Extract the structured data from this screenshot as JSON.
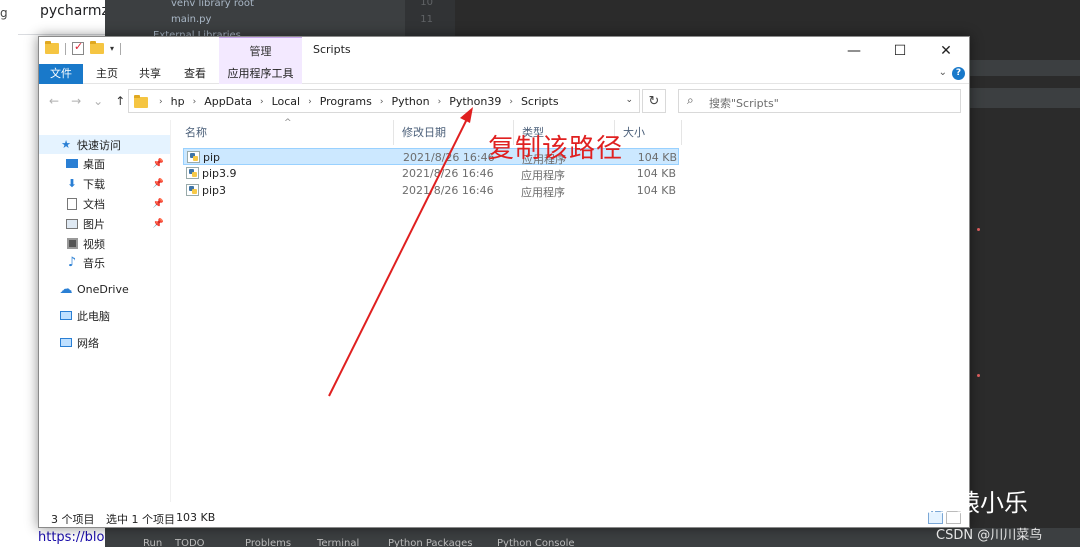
{
  "background": {
    "browser": {
      "partial_text": "g",
      "tab_title": "pycharmz",
      "url_partial": "https://blog"
    },
    "ide": {
      "tree_rows": [
        {
          "label": "venv  library root"
        },
        {
          "label": "main.py"
        },
        {
          "label": "External Libraries"
        }
      ],
      "line_numbers": [
        "10",
        "11"
      ],
      "bottom_tabs": [
        "Run",
        "TODO",
        "Problems",
        "Terminal",
        "Python Packages",
        "Python Console"
      ]
    }
  },
  "explorer": {
    "window_title": "Scripts",
    "context_tab": "管理",
    "caption": {
      "minimize": "—",
      "maximize": "☐",
      "close": "✕"
    },
    "ribbon_tabs": [
      "文件",
      "主页",
      "共享",
      "查看",
      "应用程序工具"
    ],
    "nav": {
      "back": "←",
      "forward": "→",
      "recent": "⌄",
      "up": "↑"
    },
    "breadcrumb": [
      "hp",
      "AppData",
      "Local",
      "Programs",
      "Python",
      "Python39",
      "Scripts"
    ],
    "search_placeholder": "搜索\"Scripts\"",
    "sidebar": [
      {
        "label": "快速访问",
        "icon": "star-icon",
        "pinned": false,
        "active": true
      },
      {
        "label": "桌面",
        "icon": "desktop-icon",
        "pinned": true
      },
      {
        "label": "下载",
        "icon": "download-icon",
        "pinned": true
      },
      {
        "label": "文档",
        "icon": "document-icon",
        "pinned": true
      },
      {
        "label": "图片",
        "icon": "picture-icon",
        "pinned": true
      },
      {
        "label": "视频",
        "icon": "video-icon",
        "pinned": false
      },
      {
        "label": "音乐",
        "icon": "music-icon",
        "pinned": false
      },
      {
        "label": "OneDrive",
        "icon": "cloud-icon",
        "pinned": false
      },
      {
        "label": "此电脑",
        "icon": "computer-icon",
        "pinned": false
      },
      {
        "label": "网络",
        "icon": "network-icon",
        "pinned": false
      }
    ],
    "columns": {
      "name": "名称",
      "date": "修改日期",
      "type": "类型",
      "size": "大小"
    },
    "files": [
      {
        "name": "pip",
        "date": "2021/8/26 16:46",
        "type": "应用程序",
        "size": "104 KB",
        "selected": true
      },
      {
        "name": "pip3.9",
        "date": "2021/8/26 16:46",
        "type": "应用程序",
        "size": "104 KB",
        "selected": false
      },
      {
        "name": "pip3",
        "date": "2021/8/26 16:46",
        "type": "应用程序",
        "size": "104 KB",
        "selected": false
      }
    ],
    "status": {
      "count": "3 个项目",
      "selected": "选中 1 个项目",
      "size": "103 KB"
    }
  },
  "annotation": {
    "text": "复制该路径",
    "color": "#e02020"
  },
  "watermarks": {
    "wechat": "程序猿小乐",
    "csdn": "CSDN @川川菜鸟"
  },
  "colors": {
    "file_tab": "#1979ca",
    "selection": "#cce8ff",
    "context_tab": "#f3e9ff",
    "ide_bg": "#2b2b2b"
  }
}
